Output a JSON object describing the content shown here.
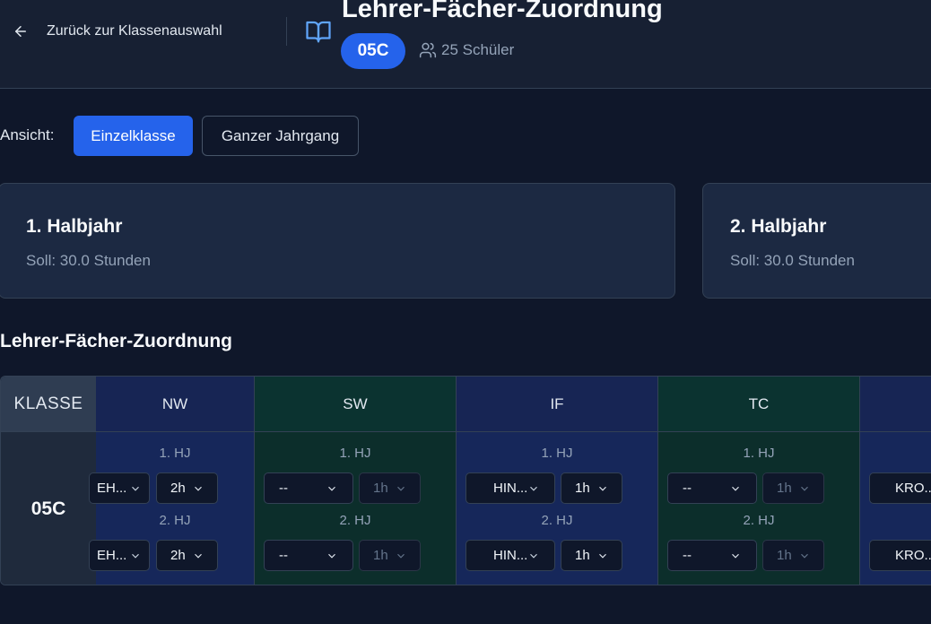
{
  "header": {
    "back_label": "Zurück zur Klassenauswahl",
    "title": "Lehrer-Fächer-Zuordnung",
    "class_badge": "05C",
    "students": "25 Schüler"
  },
  "view": {
    "label": "Ansicht:",
    "options": [
      "Einzelklasse",
      "Ganzer Jahrgang"
    ],
    "selected": "Einzelklasse"
  },
  "semesters": [
    {
      "title": "1. Halbjahr",
      "soll": "Soll: 30.0 Stunden"
    },
    {
      "title": "2. Halbjahr",
      "soll": "Soll: 30.0 Stunden"
    }
  ],
  "section_title": "Lehrer-Fächer-Zuordnung",
  "table": {
    "klasse_header": "KLASSE",
    "klasse_value": "05C",
    "hj1_label": "1. HJ",
    "hj2_label": "2. HJ",
    "subjects": [
      {
        "name": "NW",
        "hj1_teacher": "EH...",
        "hj1_hours": "2h",
        "hj2_teacher": "EH...",
        "hj2_hours": "2h"
      },
      {
        "name": "SW",
        "hj1_teacher": "--",
        "hj1_hours": "1h",
        "hj2_teacher": "--",
        "hj2_hours": "1h"
      },
      {
        "name": "IF",
        "hj1_teacher": "HIN...",
        "hj1_hours": "1h",
        "hj2_teacher": "HIN...",
        "hj2_hours": "1h"
      },
      {
        "name": "TC",
        "hj1_teacher": "--",
        "hj1_hours": "1h",
        "hj2_teacher": "--",
        "hj2_hours": "1h"
      },
      {
        "name": "",
        "hj1_teacher": "KRO...",
        "hj1_hours": "",
        "hj2_teacher": "KRO...",
        "hj2_hours": ""
      }
    ]
  },
  "colors": {
    "accent": "#2563eb",
    "background": "#0f172a",
    "blue_col": "#172554",
    "green_col": "#0b3330"
  }
}
